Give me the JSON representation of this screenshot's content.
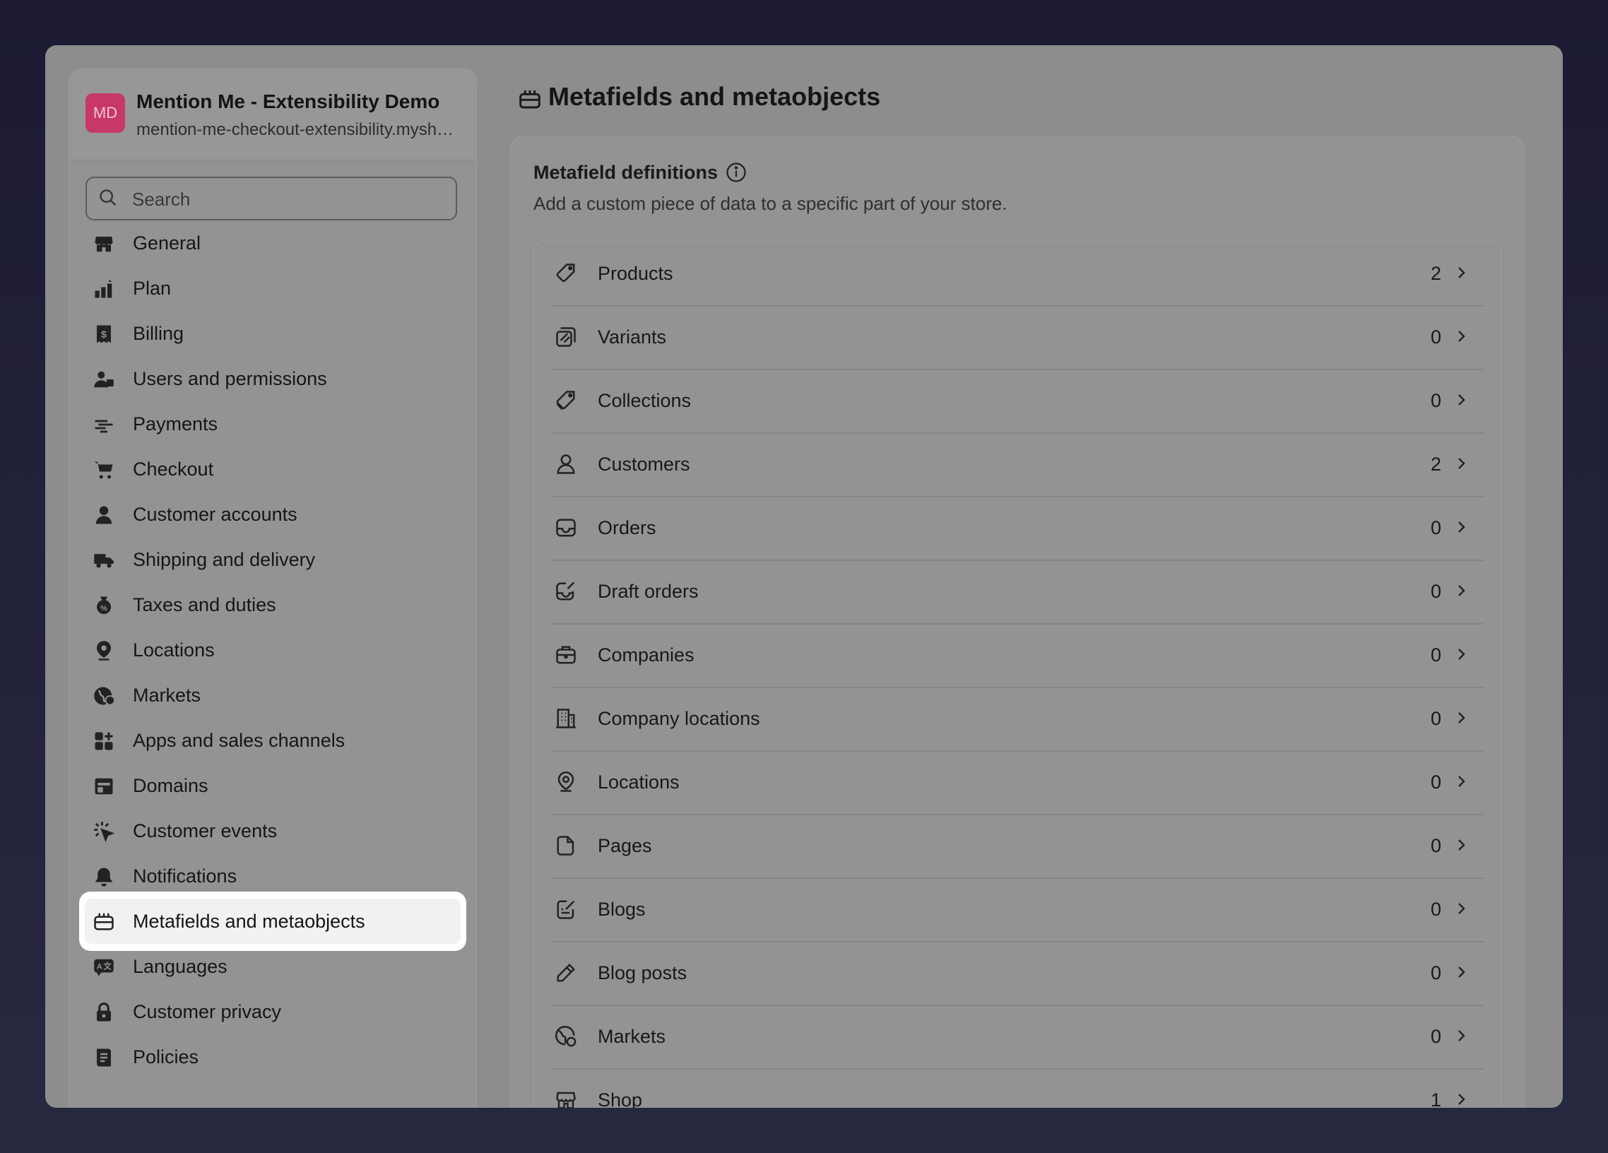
{
  "store": {
    "initials": "MD",
    "name": "Mention Me - Extensibility Demo",
    "url": "mention-me-checkout-extensibility.myshopify.com"
  },
  "search": {
    "placeholder": "Search"
  },
  "nav": [
    {
      "label": "General",
      "icon": "store-icon"
    },
    {
      "label": "Plan",
      "icon": "plan-icon"
    },
    {
      "label": "Billing",
      "icon": "billing-icon"
    },
    {
      "label": "Users and permissions",
      "icon": "users-icon"
    },
    {
      "label": "Payments",
      "icon": "payments-icon"
    },
    {
      "label": "Checkout",
      "icon": "cart-icon"
    },
    {
      "label": "Customer accounts",
      "icon": "person-icon"
    },
    {
      "label": "Shipping and delivery",
      "icon": "truck-icon"
    },
    {
      "label": "Taxes and duties",
      "icon": "tax-icon"
    },
    {
      "label": "Locations",
      "icon": "location-icon"
    },
    {
      "label": "Markets",
      "icon": "globe-icon"
    },
    {
      "label": "Apps and sales channels",
      "icon": "apps-icon"
    },
    {
      "label": "Domains",
      "icon": "domains-icon"
    },
    {
      "label": "Customer events",
      "icon": "events-icon"
    },
    {
      "label": "Notifications",
      "icon": "bell-icon"
    },
    {
      "label": "Metafields and metaobjects",
      "icon": "metafields-icon",
      "active": true
    },
    {
      "label": "Languages",
      "icon": "languages-icon"
    },
    {
      "label": "Customer privacy",
      "icon": "lock-icon"
    },
    {
      "label": "Policies",
      "icon": "policies-icon"
    }
  ],
  "main": {
    "title": "Metafields and metaobjects",
    "card_title": "Metafield definitions",
    "card_subtitle": "Add a custom piece of data to a specific part of your store.",
    "rows": [
      {
        "label": "Products",
        "count": "2",
        "icon": "tag-icon"
      },
      {
        "label": "Variants",
        "count": "0",
        "icon": "variant-icon"
      },
      {
        "label": "Collections",
        "count": "0",
        "icon": "collection-icon"
      },
      {
        "label": "Customers",
        "count": "2",
        "icon": "person-outline-icon"
      },
      {
        "label": "Orders",
        "count": "0",
        "icon": "inbox-icon"
      },
      {
        "label": "Draft orders",
        "count": "0",
        "icon": "draft-icon"
      },
      {
        "label": "Companies",
        "count": "0",
        "icon": "briefcase-icon"
      },
      {
        "label": "Company locations",
        "count": "0",
        "icon": "building-icon"
      },
      {
        "label": "Locations",
        "count": "0",
        "icon": "pin-outline-icon"
      },
      {
        "label": "Pages",
        "count": "0",
        "icon": "page-icon"
      },
      {
        "label": "Blogs",
        "count": "0",
        "icon": "blog-icon"
      },
      {
        "label": "Blog posts",
        "count": "0",
        "icon": "pencil-icon"
      },
      {
        "label": "Markets",
        "count": "0",
        "icon": "globe-outline-icon"
      },
      {
        "label": "Shop",
        "count": "1",
        "icon": "shop-outline-icon"
      }
    ]
  }
}
